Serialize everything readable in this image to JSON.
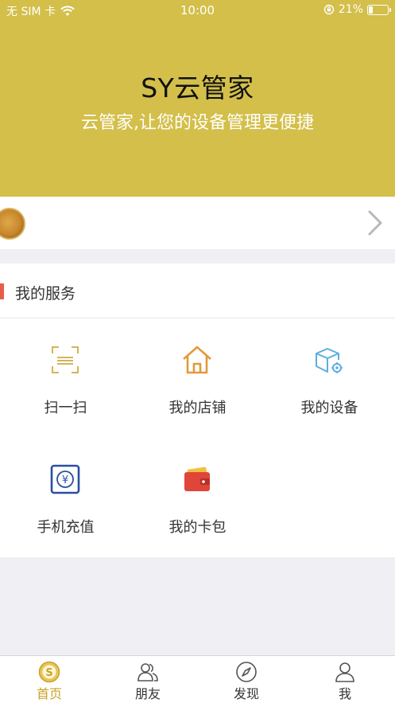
{
  "status_bar": {
    "carrier": "无 SIM 卡",
    "time": "10:00",
    "battery_percent": "21%"
  },
  "header": {
    "title": "SY云管家",
    "subtitle": "云管家,让您的设备管理更便捷",
    "background_color": "#d3bf4a"
  },
  "services": {
    "section_title": "我的服务",
    "accent_color": "#e85d4a",
    "items": [
      {
        "label": "扫一扫",
        "icon": "scan-icon"
      },
      {
        "label": "我的店铺",
        "icon": "shop-icon"
      },
      {
        "label": "我的设备",
        "icon": "device-icon"
      },
      {
        "label": "手机充值",
        "icon": "recharge-icon"
      },
      {
        "label": "我的卡包",
        "icon": "wallet-icon"
      }
    ]
  },
  "tabbar": {
    "active_color": "#c9a227",
    "tabs": [
      {
        "label": "首页",
        "icon": "home-icon",
        "active": true
      },
      {
        "label": "朋友",
        "icon": "friends-icon",
        "active": false
      },
      {
        "label": "发现",
        "icon": "compass-icon",
        "active": false
      },
      {
        "label": "我",
        "icon": "user-icon",
        "active": false
      }
    ]
  }
}
